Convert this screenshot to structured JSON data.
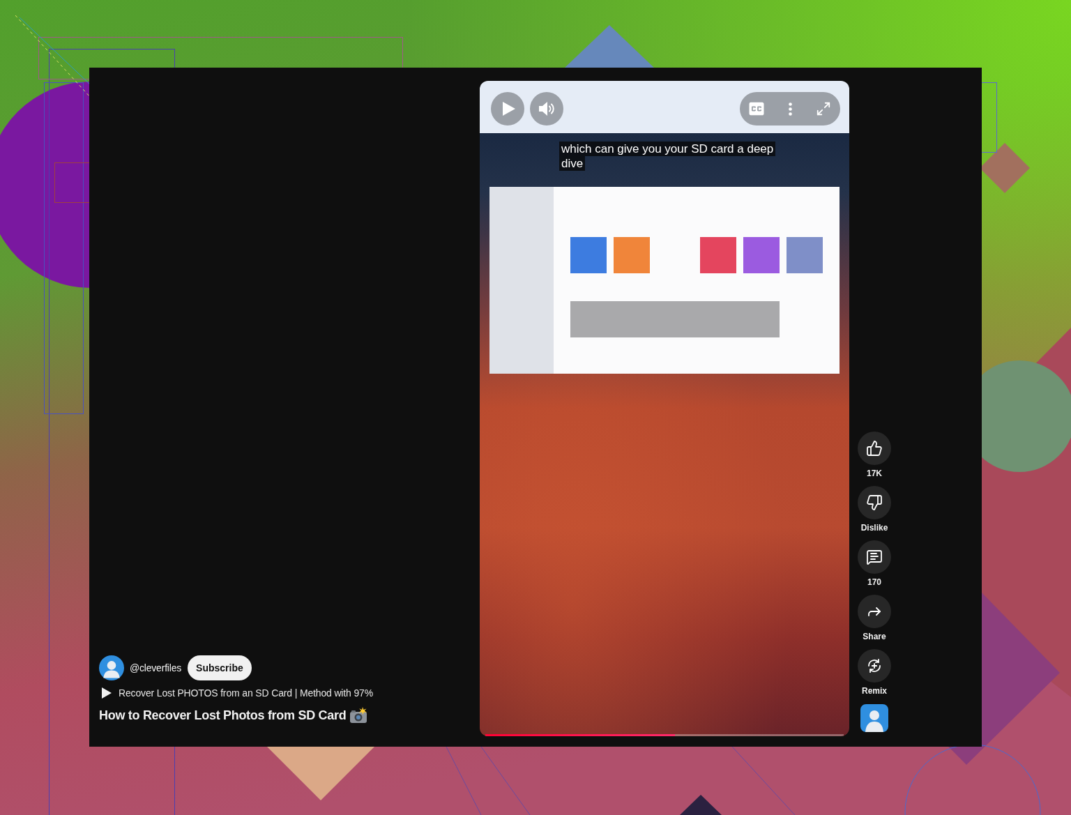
{
  "player": {
    "playing": false,
    "muted": false,
    "captions_on": true,
    "caption_lines": [
      "which can give you your SD card a deep",
      "dive"
    ],
    "progress": {
      "level": 0.53
    }
  },
  "actions": [
    {
      "kind": "like",
      "label": "17K"
    },
    {
      "kind": "dislike",
      "label": "Dislike"
    },
    {
      "kind": "comments",
      "label": "170"
    },
    {
      "kind": "share",
      "label": "Share"
    },
    {
      "kind": "remix",
      "label": "Remix"
    }
  ],
  "channel": {
    "handle": "@cleverfiles",
    "subscribe": "Subscribe"
  },
  "related_video": "Recover Lost PHOTOS from an SD Card | Method with 97%",
  "title": "How to Recover Lost Photos from SD Card"
}
